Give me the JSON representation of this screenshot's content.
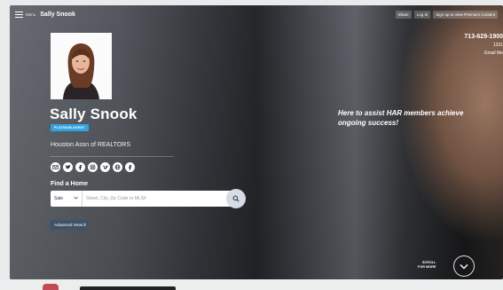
{
  "topbar": {
    "menu_label": "Menu",
    "brand": "Sally Snook",
    "share_label": "Share",
    "login_label": "Log In",
    "signup_label": "Sign up to view Premium Content"
  },
  "contact": {
    "phone": "713-629-1900",
    "extension": "1331",
    "email_label": "Email Me"
  },
  "agent": {
    "name": "Sally Snook",
    "badge": "PLATINUM AGENT",
    "organization": "Houston Assn of REALTORS"
  },
  "socials": [
    {
      "icon": "email-icon"
    },
    {
      "icon": "twitter-icon"
    },
    {
      "icon": "facebook-icon"
    },
    {
      "icon": "instagram-icon"
    },
    {
      "icon": "vimeo-icon"
    },
    {
      "icon": "website-icon"
    },
    {
      "icon": "facebook-page-icon"
    }
  ],
  "search": {
    "title": "Find a Home",
    "type_selected": "Sale",
    "placeholder": "Street, City, Zip Code or MLS#",
    "advanced_label": "Advanced Search"
  },
  "tagline": "Here to assist HAR members achieve ongoing success!",
  "scroll": {
    "line1": "SCROLL",
    "line2": "FOR MORE"
  },
  "colors": {
    "badge": "#33a3e2",
    "advanced_button": "#3f5266",
    "search_button": "#d7dbe3"
  }
}
